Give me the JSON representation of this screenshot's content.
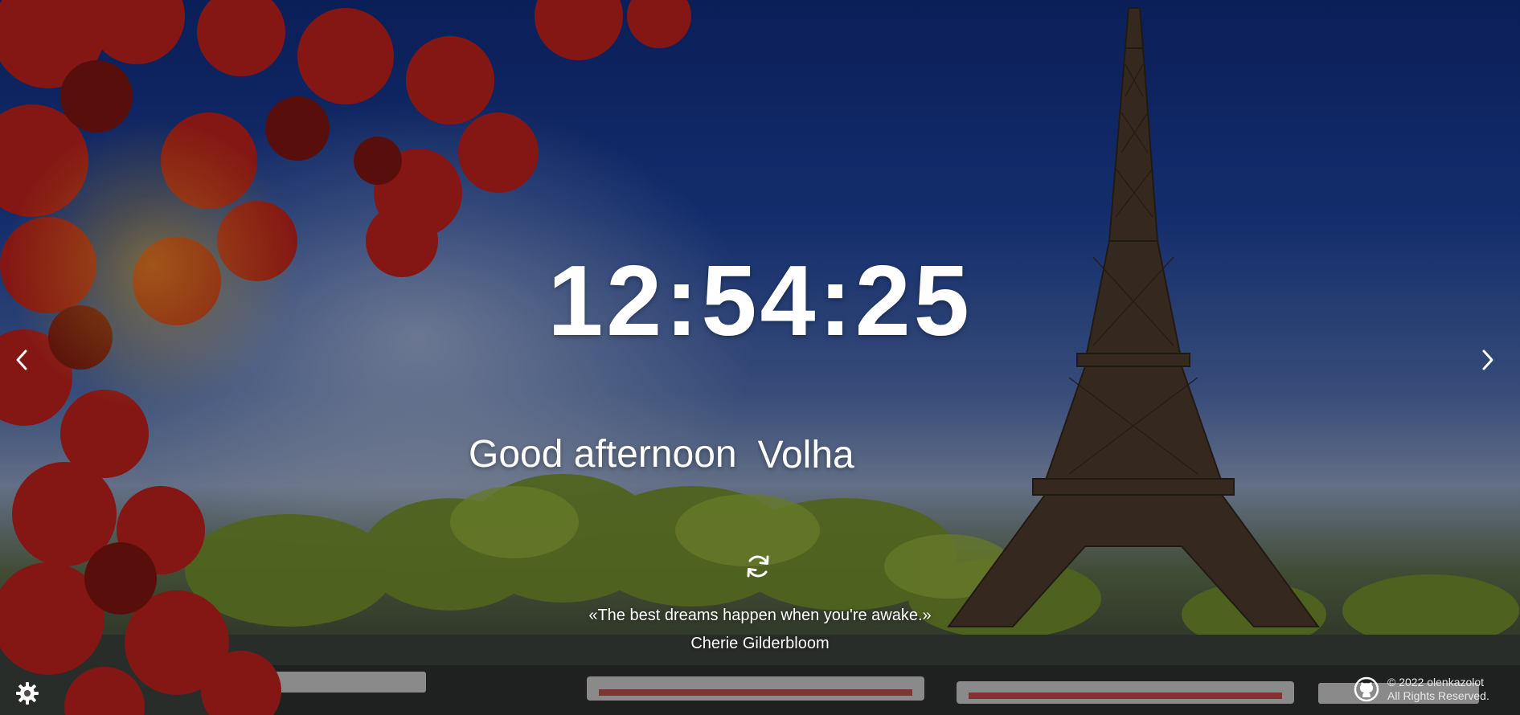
{
  "clock": {
    "time": "12:54:25"
  },
  "greeting": {
    "text": "Good afternoon",
    "name_value": "Volha"
  },
  "quote": {
    "text": "«The best dreams happen when you're awake.»",
    "author": "Cherie Gilderbloom"
  },
  "footer": {
    "copyright": "© 2022 olenkazolot",
    "rights": "All Rights Reserved."
  },
  "icons": {
    "prev": "chevron-left-icon",
    "next": "chevron-right-icon",
    "refresh": "refresh-icon",
    "settings": "gear-icon",
    "github": "github-icon"
  },
  "colors": {
    "text": "#ffffff",
    "sky_top": "#0f2a7a",
    "leaves": "#b8201c"
  }
}
